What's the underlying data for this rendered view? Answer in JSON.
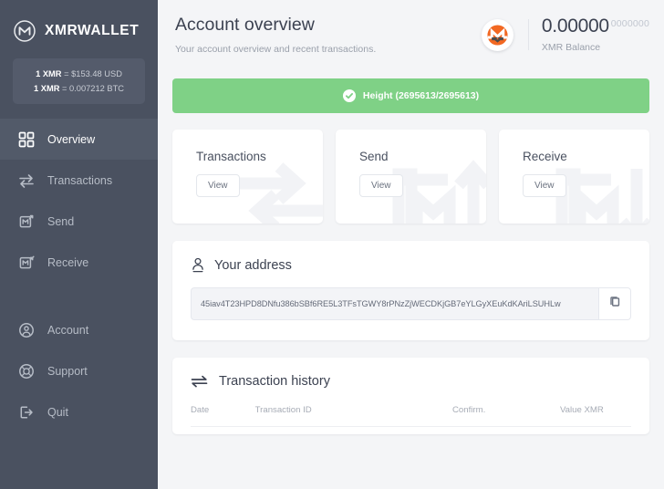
{
  "sidebar": {
    "brand": {
      "name": "XMRWALLET",
      "logo_icon": "xmr-logo-icon"
    },
    "rates": [
      {
        "unit": "1 XMR",
        "eq": "=",
        "value": "$153.48 USD"
      },
      {
        "unit": "1 XMR",
        "eq": "=",
        "value": "0.007212 BTC"
      }
    ],
    "nav_primary": [
      {
        "label": "Overview",
        "icon": "grid-icon",
        "active": true
      },
      {
        "label": "Transactions",
        "icon": "exchange-arrows-icon",
        "active": false
      },
      {
        "label": "Send",
        "icon": "send-up-icon",
        "active": false
      },
      {
        "label": "Receive",
        "icon": "receive-down-icon",
        "active": false
      }
    ],
    "nav_secondary": [
      {
        "label": "Account",
        "icon": "user-circle-icon",
        "active": false
      },
      {
        "label": "Support",
        "icon": "lifebuoy-icon",
        "active": false
      },
      {
        "label": "Quit",
        "icon": "logout-icon",
        "active": false
      }
    ]
  },
  "header": {
    "title": "Account overview",
    "subtitle": "Your account overview and recent transactions.",
    "badge_icon": "monero-logo-icon",
    "balance_main": "0.00000",
    "balance_fraction": "0000000",
    "balance_label": "XMR Balance"
  },
  "sync": {
    "icon": "check-circle-icon",
    "label": "Height (2695613/2695613)",
    "color": "#7fd186"
  },
  "cards": [
    {
      "title": "Transactions",
      "button": "View",
      "watermark_icon": "exchange-arrows-watermark"
    },
    {
      "title": "Send",
      "button": "View",
      "watermark_icon": "send-up-watermark"
    },
    {
      "title": "Receive",
      "button": "View",
      "watermark_icon": "receive-down-watermark"
    }
  ],
  "address": {
    "icon": "user-pin-icon",
    "title": "Your address",
    "value": "45iav4T23HPD8DNfu386bSBf6RE5L3TFsTGWY8rPNzZjWECDKjGB7eYLGyXEuKdKAriLSUHLw",
    "copy_icon": "copy-icon"
  },
  "transactions": {
    "icon": "exchange-arrows-icon",
    "title": "Transaction history",
    "columns": [
      "Date",
      "Transaction ID",
      "Confirm.",
      "Value XMR"
    ],
    "rows": []
  },
  "colors": {
    "sidebar_bg": "#4a5160",
    "accent_green": "#7fd186",
    "monero_orange": "#f26822",
    "page_bg": "#f4f5f7"
  }
}
